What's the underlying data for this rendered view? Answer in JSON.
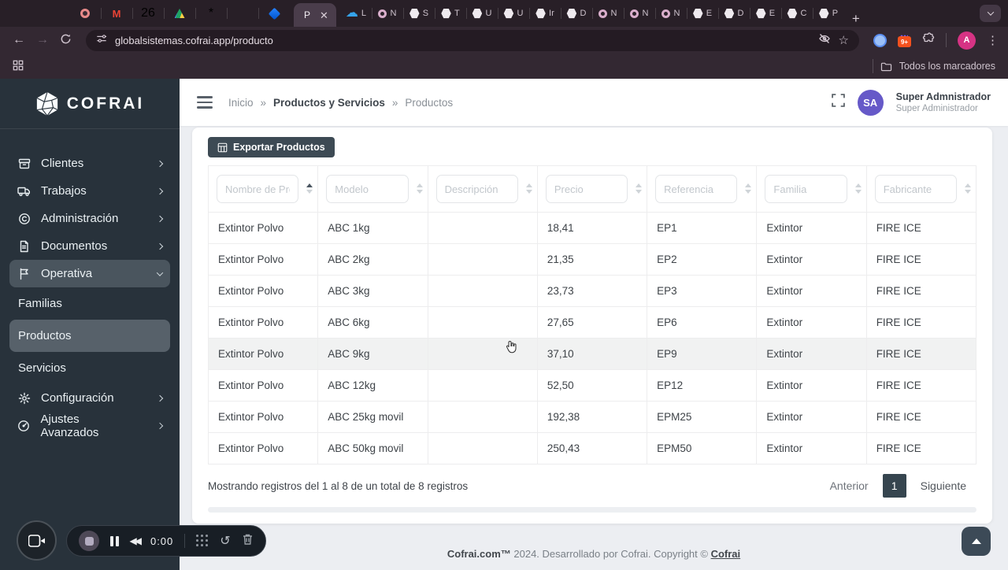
{
  "browser": {
    "url": "globalsistemas.cofrai.app/producto",
    "bookmarks_label": "Todos los marcadores",
    "active_tab": {
      "label": "P"
    },
    "extension_badge": "9+",
    "profile_initial": "A",
    "pinned_tabs_left": [
      {
        "icon": "record",
        "label": ""
      },
      {
        "icon": "gmail",
        "glyph": "M",
        "label": ""
      },
      {
        "icon": "calendar",
        "glyph": "26",
        "label": ""
      },
      {
        "icon": "drive",
        "label": ""
      },
      {
        "icon": "hubspot",
        "glyph": "*",
        "label": ""
      },
      {
        "icon": "whatsapp",
        "label": ""
      },
      {
        "icon": "jira",
        "label": ""
      }
    ],
    "pinned_tabs_right": [
      {
        "icon": "cloud",
        "label": "L"
      },
      {
        "icon": "circle",
        "label": "N"
      },
      {
        "icon": "hex",
        "label": "S"
      },
      {
        "icon": "hex",
        "label": "T"
      },
      {
        "icon": "hex",
        "label": "U"
      },
      {
        "icon": "hex",
        "label": "U"
      },
      {
        "icon": "hex",
        "label": "Ir"
      },
      {
        "icon": "hex",
        "label": "D"
      },
      {
        "icon": "circle",
        "label": "N"
      },
      {
        "icon": "circle",
        "label": "N"
      },
      {
        "icon": "circle",
        "label": "N"
      },
      {
        "icon": "hex",
        "label": "E"
      },
      {
        "icon": "hex",
        "label": "D"
      },
      {
        "icon": "hex",
        "label": "E"
      },
      {
        "icon": "hex",
        "label": "C"
      },
      {
        "icon": "hex",
        "label": "P"
      }
    ]
  },
  "sidebar": {
    "brand": "COFRAI",
    "items": [
      {
        "label": "Clientes",
        "icon": "clients",
        "chevron": "right"
      },
      {
        "label": "Trabajos",
        "icon": "truck",
        "chevron": "right"
      },
      {
        "label": "Administración",
        "icon": "copyright",
        "chevron": "right"
      },
      {
        "label": "Documentos",
        "icon": "document",
        "chevron": "right"
      },
      {
        "label": "Operativa",
        "icon": "flag",
        "chevron": "down",
        "active": true,
        "children": [
          {
            "label": "Familias",
            "active": false
          },
          {
            "label": "Productos",
            "active": true
          },
          {
            "label": "Servicios",
            "active": false
          }
        ]
      },
      {
        "label": "Configuración",
        "icon": "gear",
        "chevron": "right"
      },
      {
        "label": "Ajustes Avanzados",
        "icon": "gauge",
        "chevron": "right"
      }
    ]
  },
  "header": {
    "breadcrumb": [
      {
        "label": "Inicio",
        "bold": false
      },
      {
        "label": "Productos y Servicios",
        "bold": true
      },
      {
        "label": "Productos",
        "bold": false
      }
    ],
    "separator": "»",
    "user": {
      "initials": "SA",
      "name": "Super Admnistrador",
      "role": "Super Administrador"
    }
  },
  "toolbar": {
    "export_label": "Exportar Productos"
  },
  "table": {
    "columns": [
      {
        "placeholder": "Nombre de Pro",
        "sort": "asc"
      },
      {
        "placeholder": "Modelo",
        "sort": ""
      },
      {
        "placeholder": "Descripción",
        "sort": ""
      },
      {
        "placeholder": "Precio",
        "sort": ""
      },
      {
        "placeholder": "Referencia",
        "sort": ""
      },
      {
        "placeholder": "Familia",
        "sort": ""
      },
      {
        "placeholder": "Fabricante",
        "sort": ""
      }
    ],
    "rows": [
      [
        "Extintor Polvo",
        "ABC 1kg",
        "",
        "18,41",
        "EP1",
        "Extintor",
        "FIRE ICE"
      ],
      [
        "Extintor Polvo",
        "ABC 2kg",
        "",
        "21,35",
        "EP2",
        "Extintor",
        "FIRE ICE"
      ],
      [
        "Extintor Polvo",
        "ABC 3kg",
        "",
        "23,73",
        "EP3",
        "Extintor",
        "FIRE ICE"
      ],
      [
        "Extintor Polvo",
        "ABC 6kg",
        "",
        "27,65",
        "EP6",
        "Extintor",
        "FIRE ICE"
      ],
      [
        "Extintor Polvo",
        "ABC 9kg",
        "",
        "37,10",
        "EP9",
        "Extintor",
        "FIRE ICE"
      ],
      [
        "Extintor Polvo",
        "ABC 12kg",
        "",
        "52,50",
        "EP12",
        "Extintor",
        "FIRE ICE"
      ],
      [
        "Extintor Polvo",
        "ABC 25kg movil",
        "",
        "192,38",
        "EPM25",
        "Extintor",
        "FIRE ICE"
      ],
      [
        "Extintor Polvo",
        "ABC 50kg movil",
        "",
        "250,43",
        "EPM50",
        "Extintor",
        "FIRE ICE"
      ]
    ],
    "hovered_row_index": 4
  },
  "pagination": {
    "info": "Mostrando registros del 1 al 8 de un total de 8 registros",
    "prev": "Anterior",
    "page": "1",
    "next": "Siguiente"
  },
  "footer": {
    "brand": "Cofrai.com™",
    "text": " 2024. Desarrollado por Cofrai. Copyright © ",
    "link": "Cofrai"
  },
  "recorder": {
    "time": "0:00"
  },
  "colors": {
    "sidebar_bg": "#28323b",
    "accent_dark": "#36454f",
    "avatar_purple": "#6659c8",
    "chrome_bg": "#332832"
  }
}
